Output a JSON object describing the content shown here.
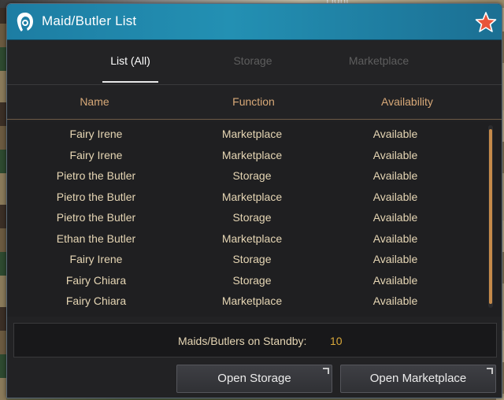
{
  "background": {
    "top_text": "Light"
  },
  "window": {
    "title": "Maid/Butler List",
    "title_icon": "maid-head-icon",
    "close_icon": "star-close-icon",
    "accent_color": "#1d7da3"
  },
  "tabs": [
    {
      "label": "List (All)",
      "active": true
    },
    {
      "label": "Storage",
      "active": false
    },
    {
      "label": "Marketplace",
      "active": false
    }
  ],
  "columns": {
    "name": "Name",
    "function": "Function",
    "availability": "Availability"
  },
  "rows": [
    {
      "name": "Fairy Irene",
      "function": "Marketplace",
      "availability": "Available"
    },
    {
      "name": "Fairy Irene",
      "function": "Marketplace",
      "availability": "Available"
    },
    {
      "name": "Pietro the Butler",
      "function": "Storage",
      "availability": "Available"
    },
    {
      "name": "Pietro the Butler",
      "function": "Marketplace",
      "availability": "Available"
    },
    {
      "name": "Pietro the Butler",
      "function": "Storage",
      "availability": "Available"
    },
    {
      "name": "Ethan the Butler",
      "function": "Marketplace",
      "availability": "Available"
    },
    {
      "name": "Fairy Irene",
      "function": "Storage",
      "availability": "Available"
    },
    {
      "name": "Fairy Chiara",
      "function": "Storage",
      "availability": "Available"
    },
    {
      "name": "Fairy Chiara",
      "function": "Marketplace",
      "availability": "Available"
    }
  ],
  "standby": {
    "label": "Maids/Butlers on Standby:",
    "value": "10"
  },
  "buttons": {
    "open_storage": "Open Storage",
    "open_marketplace": "Open Marketplace"
  }
}
